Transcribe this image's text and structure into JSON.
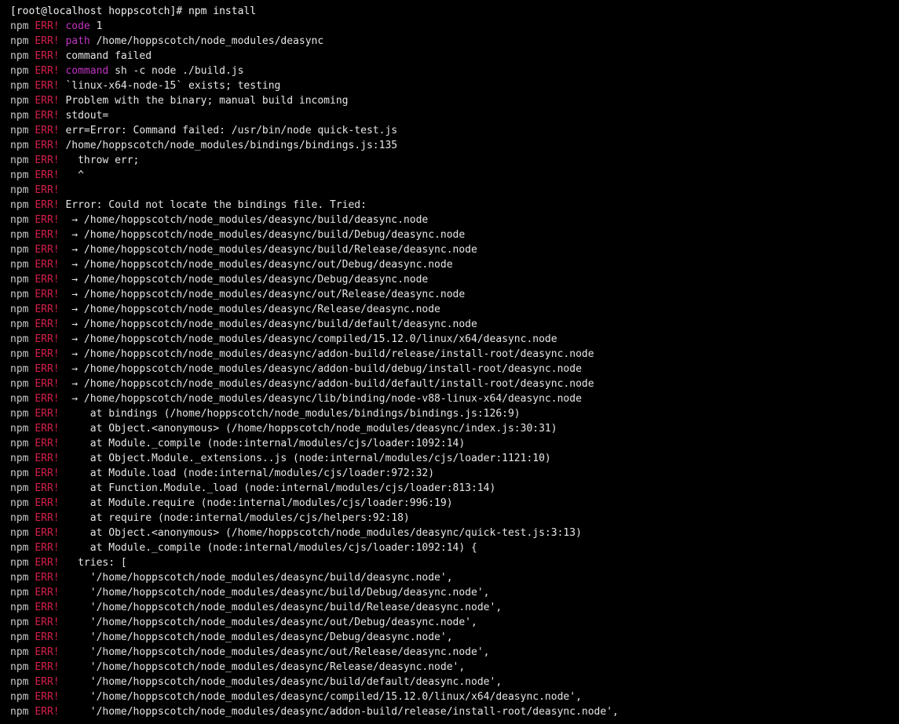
{
  "window": {
    "partial_top_text": "                        ",
    "prompt": "[root@localhost hoppscotch]# npm install"
  },
  "colors": {
    "background": "#000000",
    "text": "#e6e6e6",
    "npm": "#c8c8c8",
    "err": "#d4204a",
    "keyword": "#c235c2"
  },
  "log": [
    {
      "prefix": "npm",
      "level": "ERR!",
      "key": "code",
      "text": " 1"
    },
    {
      "prefix": "npm",
      "level": "ERR!",
      "key": "path",
      "text": " /home/hoppscotch/node_modules/deasync"
    },
    {
      "prefix": "npm",
      "level": "ERR!",
      "key": "",
      "text": "command failed"
    },
    {
      "prefix": "npm",
      "level": "ERR!",
      "key": "command",
      "text": " sh -c node ./build.js"
    },
    {
      "prefix": "npm",
      "level": "ERR!",
      "key": "",
      "text": "`linux-x64-node-15` exists; testing"
    },
    {
      "prefix": "npm",
      "level": "ERR!",
      "key": "",
      "text": "Problem with the binary; manual build incoming"
    },
    {
      "prefix": "npm",
      "level": "ERR!",
      "key": "",
      "text": "stdout="
    },
    {
      "prefix": "npm",
      "level": "ERR!",
      "key": "",
      "text": "err=Error: Command failed: /usr/bin/node quick-test.js"
    },
    {
      "prefix": "npm",
      "level": "ERR!",
      "key": "",
      "text": "/home/hoppscotch/node_modules/bindings/bindings.js:135"
    },
    {
      "prefix": "npm",
      "level": "ERR!",
      "key": "",
      "text": "  throw err;"
    },
    {
      "prefix": "npm",
      "level": "ERR!",
      "key": "",
      "text": "  ^"
    },
    {
      "prefix": "npm",
      "level": "ERR!",
      "key": "",
      "text": ""
    },
    {
      "prefix": "npm",
      "level": "ERR!",
      "key": "",
      "text": "Error: Could not locate the bindings file. Tried:"
    },
    {
      "prefix": "npm",
      "level": "ERR!",
      "key": "",
      "text": " → /home/hoppscotch/node_modules/deasync/build/deasync.node"
    },
    {
      "prefix": "npm",
      "level": "ERR!",
      "key": "",
      "text": " → /home/hoppscotch/node_modules/deasync/build/Debug/deasync.node"
    },
    {
      "prefix": "npm",
      "level": "ERR!",
      "key": "",
      "text": " → /home/hoppscotch/node_modules/deasync/build/Release/deasync.node"
    },
    {
      "prefix": "npm",
      "level": "ERR!",
      "key": "",
      "text": " → /home/hoppscotch/node_modules/deasync/out/Debug/deasync.node"
    },
    {
      "prefix": "npm",
      "level": "ERR!",
      "key": "",
      "text": " → /home/hoppscotch/node_modules/deasync/Debug/deasync.node"
    },
    {
      "prefix": "npm",
      "level": "ERR!",
      "key": "",
      "text": " → /home/hoppscotch/node_modules/deasync/out/Release/deasync.node"
    },
    {
      "prefix": "npm",
      "level": "ERR!",
      "key": "",
      "text": " → /home/hoppscotch/node_modules/deasync/Release/deasync.node"
    },
    {
      "prefix": "npm",
      "level": "ERR!",
      "key": "",
      "text": " → /home/hoppscotch/node_modules/deasync/build/default/deasync.node"
    },
    {
      "prefix": "npm",
      "level": "ERR!",
      "key": "",
      "text": " → /home/hoppscotch/node_modules/deasync/compiled/15.12.0/linux/x64/deasync.node"
    },
    {
      "prefix": "npm",
      "level": "ERR!",
      "key": "",
      "text": " → /home/hoppscotch/node_modules/deasync/addon-build/release/install-root/deasync.node"
    },
    {
      "prefix": "npm",
      "level": "ERR!",
      "key": "",
      "text": " → /home/hoppscotch/node_modules/deasync/addon-build/debug/install-root/deasync.node"
    },
    {
      "prefix": "npm",
      "level": "ERR!",
      "key": "",
      "text": " → /home/hoppscotch/node_modules/deasync/addon-build/default/install-root/deasync.node"
    },
    {
      "prefix": "npm",
      "level": "ERR!",
      "key": "",
      "text": " → /home/hoppscotch/node_modules/deasync/lib/binding/node-v88-linux-x64/deasync.node"
    },
    {
      "prefix": "npm",
      "level": "ERR!",
      "key": "",
      "text": "    at bindings (/home/hoppscotch/node_modules/bindings/bindings.js:126:9)"
    },
    {
      "prefix": "npm",
      "level": "ERR!",
      "key": "",
      "text": "    at Object.<anonymous> (/home/hoppscotch/node_modules/deasync/index.js:30:31)"
    },
    {
      "prefix": "npm",
      "level": "ERR!",
      "key": "",
      "text": "    at Module._compile (node:internal/modules/cjs/loader:1092:14)"
    },
    {
      "prefix": "npm",
      "level": "ERR!",
      "key": "",
      "text": "    at Object.Module._extensions..js (node:internal/modules/cjs/loader:1121:10)"
    },
    {
      "prefix": "npm",
      "level": "ERR!",
      "key": "",
      "text": "    at Module.load (node:internal/modules/cjs/loader:972:32)"
    },
    {
      "prefix": "npm",
      "level": "ERR!",
      "key": "",
      "text": "    at Function.Module._load (node:internal/modules/cjs/loader:813:14)"
    },
    {
      "prefix": "npm",
      "level": "ERR!",
      "key": "",
      "text": "    at Module.require (node:internal/modules/cjs/loader:996:19)"
    },
    {
      "prefix": "npm",
      "level": "ERR!",
      "key": "",
      "text": "    at require (node:internal/modules/cjs/helpers:92:18)"
    },
    {
      "prefix": "npm",
      "level": "ERR!",
      "key": "",
      "text": "    at Object.<anonymous> (/home/hoppscotch/node_modules/deasync/quick-test.js:3:13)"
    },
    {
      "prefix": "npm",
      "level": "ERR!",
      "key": "",
      "text": "    at Module._compile (node:internal/modules/cjs/loader:1092:14) {"
    },
    {
      "prefix": "npm",
      "level": "ERR!",
      "key": "",
      "text": "  tries: ["
    },
    {
      "prefix": "npm",
      "level": "ERR!",
      "key": "",
      "text": "    '/home/hoppscotch/node_modules/deasync/build/deasync.node',"
    },
    {
      "prefix": "npm",
      "level": "ERR!",
      "key": "",
      "text": "    '/home/hoppscotch/node_modules/deasync/build/Debug/deasync.node',"
    },
    {
      "prefix": "npm",
      "level": "ERR!",
      "key": "",
      "text": "    '/home/hoppscotch/node_modules/deasync/build/Release/deasync.node',"
    },
    {
      "prefix": "npm",
      "level": "ERR!",
      "key": "",
      "text": "    '/home/hoppscotch/node_modules/deasync/out/Debug/deasync.node',"
    },
    {
      "prefix": "npm",
      "level": "ERR!",
      "key": "",
      "text": "    '/home/hoppscotch/node_modules/deasync/Debug/deasync.node',"
    },
    {
      "prefix": "npm",
      "level": "ERR!",
      "key": "",
      "text": "    '/home/hoppscotch/node_modules/deasync/out/Release/deasync.node',"
    },
    {
      "prefix": "npm",
      "level": "ERR!",
      "key": "",
      "text": "    '/home/hoppscotch/node_modules/deasync/Release/deasync.node',"
    },
    {
      "prefix": "npm",
      "level": "ERR!",
      "key": "",
      "text": "    '/home/hoppscotch/node_modules/deasync/build/default/deasync.node',"
    },
    {
      "prefix": "npm",
      "level": "ERR!",
      "key": "",
      "text": "    '/home/hoppscotch/node_modules/deasync/compiled/15.12.0/linux/x64/deasync.node',"
    },
    {
      "prefix": "npm",
      "level": "ERR!",
      "key": "",
      "text": "    '/home/hoppscotch/node_modules/deasync/addon-build/release/install-root/deasync.node',"
    }
  ]
}
